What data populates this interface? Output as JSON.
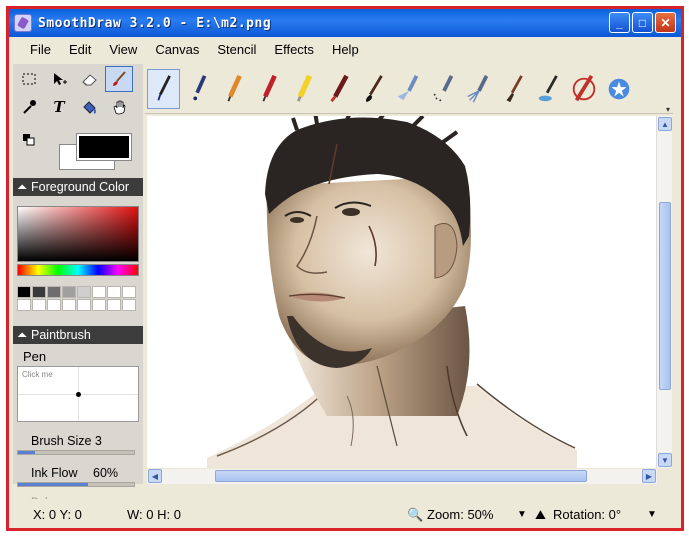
{
  "window": {
    "title": "SmoothDraw 3.2.0 - E:\\m2.png",
    "minimize": "_",
    "maximize": "□",
    "close": "✕"
  },
  "menu": [
    "File",
    "Edit",
    "View",
    "Canvas",
    "Stencil",
    "Effects",
    "Help"
  ],
  "tools": [
    {
      "name": "select-rect-icon",
      "active": false
    },
    {
      "name": "move-icon",
      "active": false
    },
    {
      "name": "eraser-icon",
      "active": false
    },
    {
      "name": "paintbrush-icon",
      "active": true
    },
    {
      "name": "eyedropper-icon",
      "active": false
    },
    {
      "name": "text-tool-icon",
      "active": false
    },
    {
      "name": "fill-bucket-icon",
      "active": false
    },
    {
      "name": "hand-icon",
      "active": false
    }
  ],
  "panels": {
    "foreground": "Foreground Color",
    "paintbrush": "Paintbrush"
  },
  "brush": {
    "name": "Pen",
    "preview_hint": "Click me",
    "size_label": "Brush Size 3",
    "size": 3,
    "ink_label": "Ink Flow",
    "ink_value": "60%",
    "ink_flow": 0.6,
    "dab_label": "Dab"
  },
  "palette": [
    "#000000",
    "#3a3a3a",
    "#6e6e6e",
    "#a0a0a0",
    "#cfcfcf",
    "#ffffff",
    "#ffffff",
    "#ffffff",
    "#ffffff",
    "#ffffff",
    "#ffffff",
    "#ffffff",
    "#ffffff",
    "#ffffff",
    "#ffffff",
    "#ffffff"
  ],
  "brushes": [
    "pen-icon",
    "ink-pen-icon",
    "pencil-icon",
    "red-pencil-icon",
    "highlighter-icon",
    "crayon-icon",
    "brush-icon",
    "spray-icon",
    "airbrush-icon",
    "sprinkle-icon",
    "flat-brush-icon",
    "water-brush-icon",
    "bristle-brush-icon",
    "star-icon"
  ],
  "status": {
    "coords": "X: 0 Y: 0",
    "size": "W: 0 H: 0",
    "zoom": "Zoom: 50%",
    "rotation": "Rotation: 0°"
  }
}
